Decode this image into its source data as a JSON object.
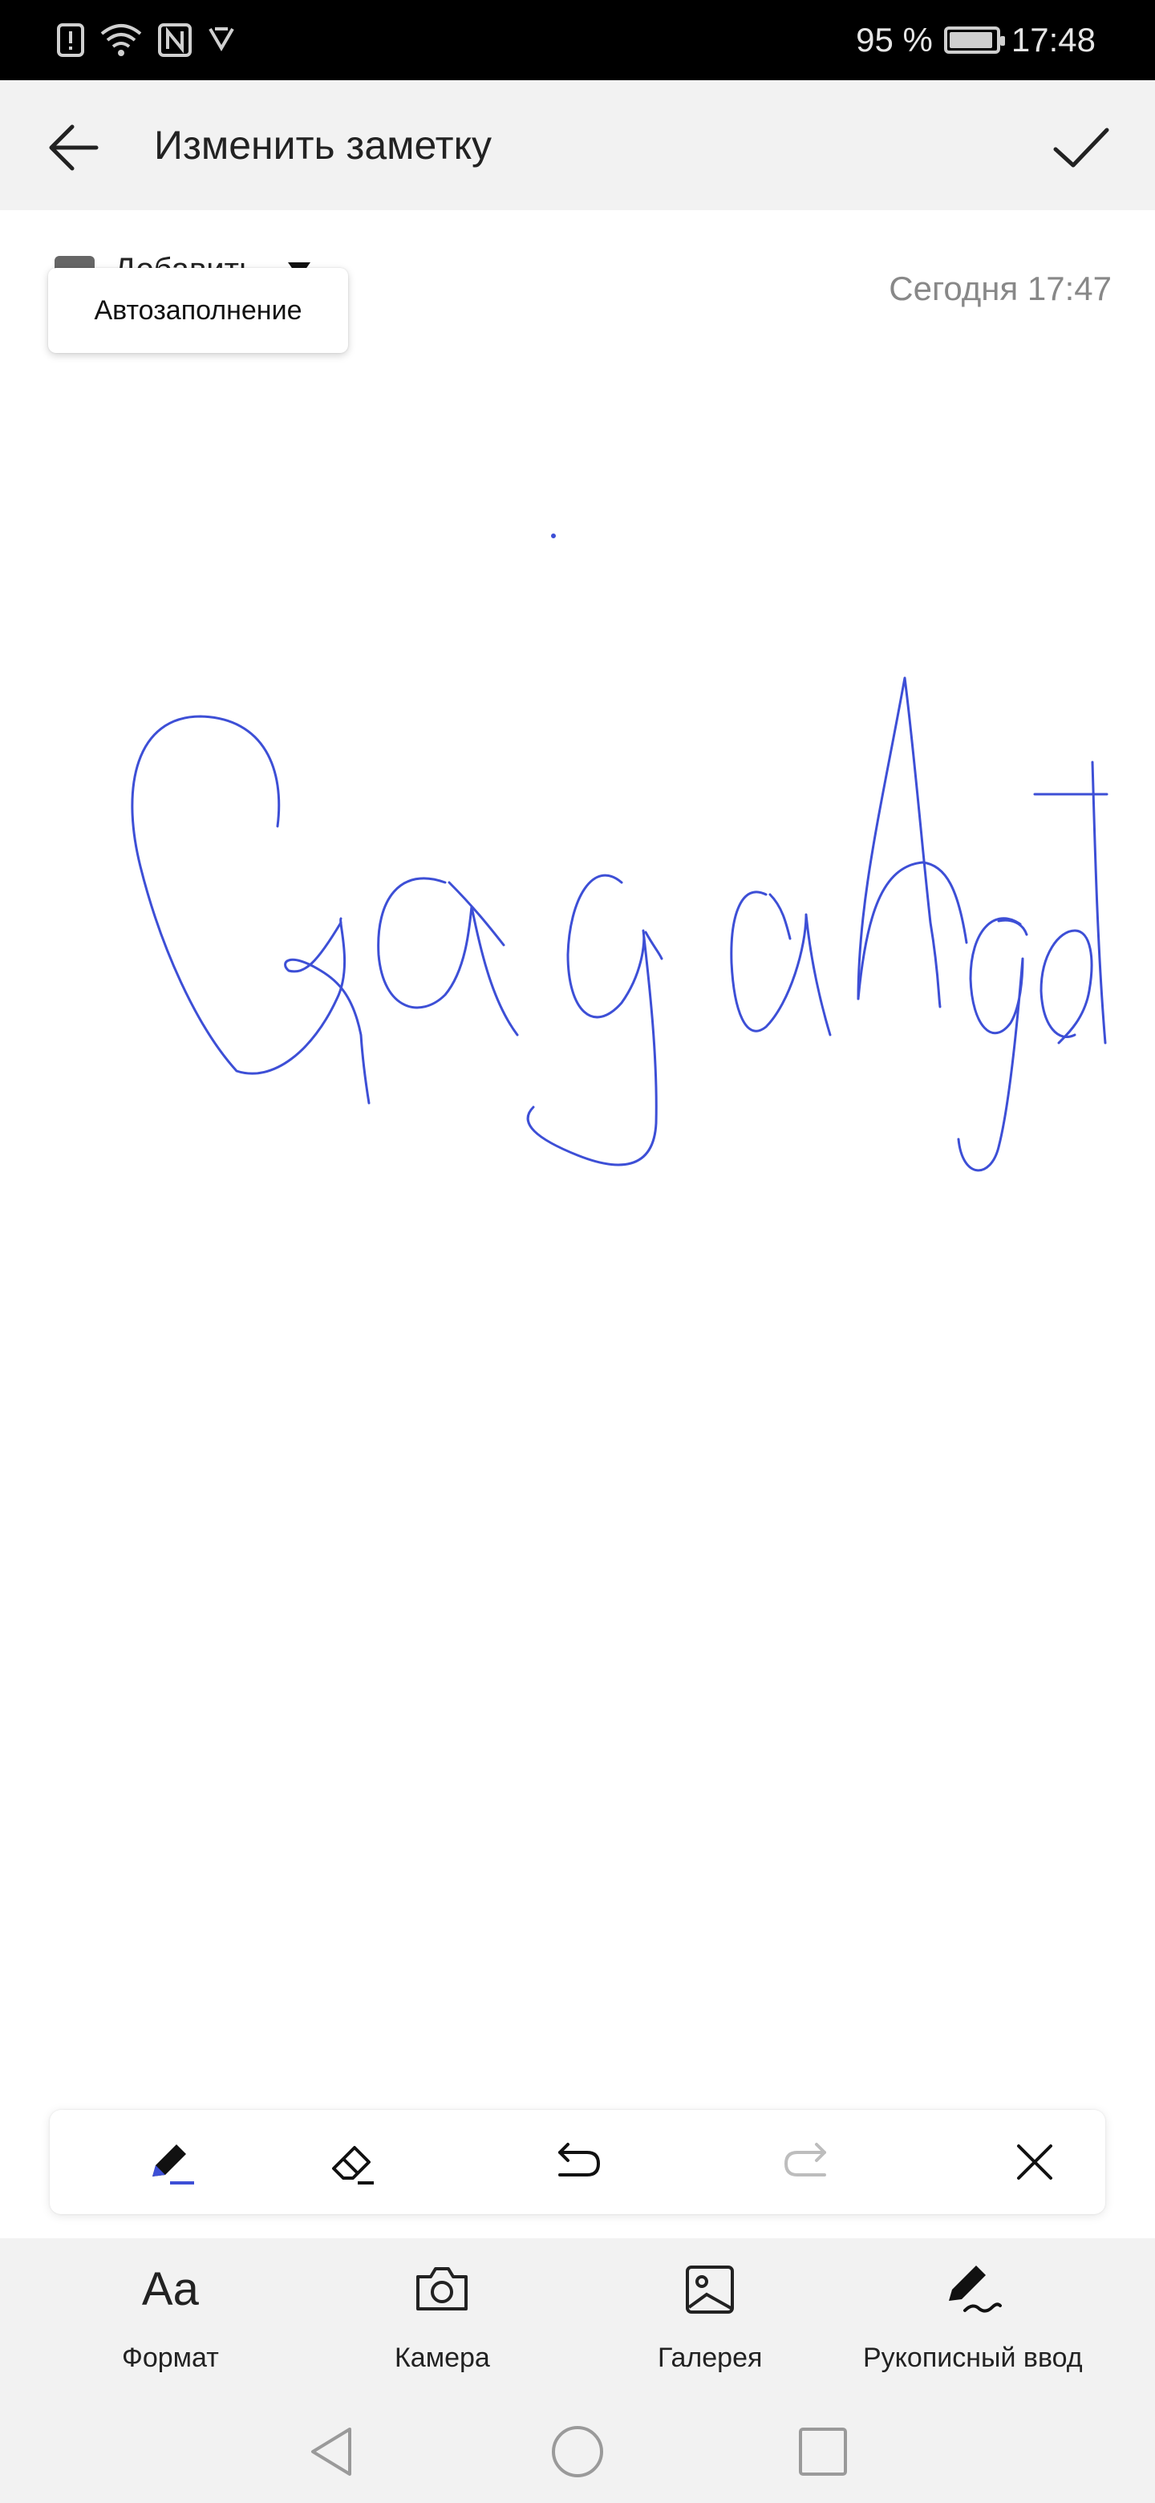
{
  "status_bar": {
    "battery_text": "95 %",
    "battery_level": 0.95,
    "time": "17:48",
    "icons": [
      "alert-icon",
      "wifi-icon",
      "nfc-icon",
      "notification-icon"
    ]
  },
  "header": {
    "title": "Изменить заметку",
    "back_icon": "arrow-left-icon",
    "confirm_icon": "check-icon"
  },
  "note": {
    "category_label": "Добавить",
    "date": "Сегодня 17:47",
    "autofill_popup": "Автозаполнение"
  },
  "handwriting_tools": {
    "tools": [
      "pen-icon",
      "eraser-icon",
      "undo-icon",
      "redo-icon",
      "close-icon"
    ],
    "pen_color": "#3d4fd6"
  },
  "bottom_bar": {
    "format_glyph": "Aa",
    "format": "Формат",
    "camera": "Камера",
    "gallery": "Галерея",
    "handwriting": "Рукописный ввод"
  },
  "nav_bar": [
    "back-triangle-icon",
    "home-circle-icon",
    "recents-square-icon"
  ],
  "colors": {
    "header_bg": "#f2f2f2",
    "stroke": "#3d4fd6",
    "date": "#888888"
  }
}
